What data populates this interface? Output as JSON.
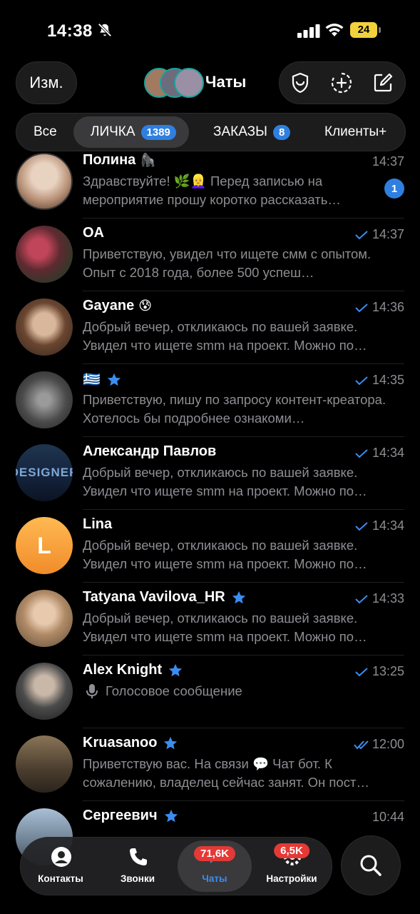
{
  "status_bar": {
    "time": "14:38",
    "battery": "24"
  },
  "header": {
    "edit_label": "Изм.",
    "title": "Чаты"
  },
  "tabs": [
    {
      "label": "Все"
    },
    {
      "label": "ЛИЧКА",
      "badge": "1389"
    },
    {
      "label": "ЗАКАЗЫ",
      "badge": "8"
    },
    {
      "label": "Клиенты+"
    }
  ],
  "chats": [
    {
      "name": "Полина",
      "emoji": "🦍",
      "time": "14:37",
      "message": "Здравствуйте! 🌿👱‍♀️ Перед записью на мероприятие прошу коротко рассказать…",
      "unread": "1",
      "avatar_color": "#c9a88b"
    },
    {
      "name": "OA",
      "time": "14:37",
      "message": "Приветствую, увидел что ищете смм с опытом. Опыт с 2018 года, более 500 успеш…",
      "avatar_color": "#7a2a35"
    },
    {
      "name": "Gayane",
      "emoji": "😰",
      "time": "14:36",
      "message": "Добрый вечер, откликаюсь по вашей заявке. Увидел что ищете smm на проект. Можно по…",
      "avatar_color": "#8a5a3a"
    },
    {
      "name": "🇬🇷",
      "time": "14:35",
      "message": "Приветствую, пишу по запросу контент-креатора. Хотелось бы подробнее ознакоми…",
      "avatar_color": "#555"
    },
    {
      "name": "Александр Павлов",
      "time": "14:34",
      "message": "Добрый вечер, откликаюсь по вашей заявке. Увидел что ищете smm на проект. Можно по…",
      "avatar_color": "#1f3550",
      "avatar_text": "DESIGNER"
    },
    {
      "name": "Lina",
      "time": "14:34",
      "message": "Добрый вечер, откликаюсь по вашей заявке. Увидел что ищете smm на проект. Можно по…",
      "avatar_color": "#f5a340",
      "avatar_text": "L"
    },
    {
      "name": "Tatyana Vavilova_HR",
      "time": "14:33",
      "message": "Добрый вечер, откликаюсь по вашей заявке. Увидел что ищете smm на проект. Можно по…",
      "avatar_color": "#b09070"
    },
    {
      "name": "Alex Knight",
      "time": "13:25",
      "message": "Голосовое сообщение",
      "avatar_color": "#3a3a3a"
    },
    {
      "name": "Kruasanoo",
      "time": "12:00",
      "message": "Приветствую вас. На связи 💬 Чат бот. К сожалению, владелец сейчас занят. Он пост…",
      "avatar_color": "#6b5a44"
    },
    {
      "name": "Сергеевич",
      "time": "10:44",
      "message": "",
      "avatar_color": "#7c8fa3"
    }
  ],
  "nav": [
    {
      "label": "Контакты"
    },
    {
      "label": "Звонки"
    },
    {
      "label": "Чаты",
      "badge": "71,6K"
    },
    {
      "label": "Настройки",
      "badge": "6,5K"
    }
  ],
  "colors": {
    "accent": "#3b8df0",
    "badge_blue": "#2f7fe0",
    "badge_red": "#e53935"
  }
}
